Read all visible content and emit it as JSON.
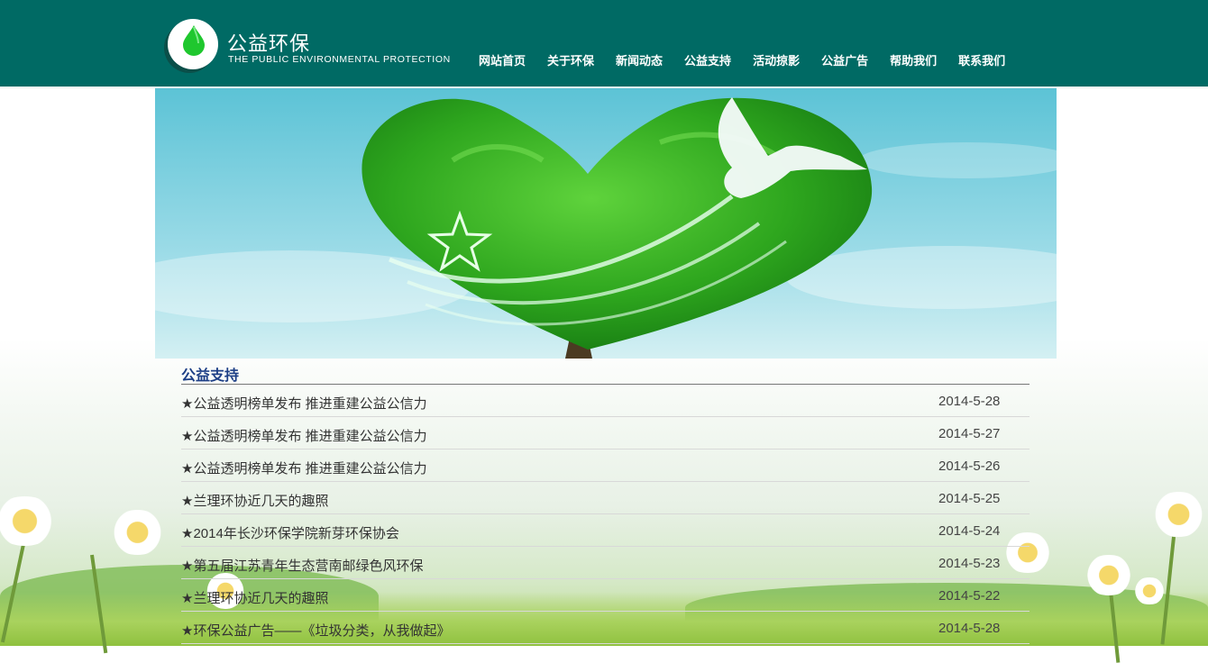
{
  "header": {
    "logo_cn": "公益环保",
    "logo_en": "THE PUBLIC ENVIRONMENTAL PROTECTION",
    "nav": [
      "网站首页",
      "关于环保",
      "新闻动态",
      "公益支持",
      "活动掠影",
      "公益广告",
      "帮助我们",
      "联系我们"
    ]
  },
  "colors": {
    "header_bg": "#006a64",
    "section_title": "#1d3f86",
    "logo_drop": "#1fc72e"
  },
  "section": {
    "title": "公益支持"
  },
  "news": [
    {
      "title": "★公益透明榜单发布 推进重建公益公信力",
      "date": "2014-5-28"
    },
    {
      "title": "★公益透明榜单发布 推进重建公益公信力",
      "date": "2014-5-27"
    },
    {
      "title": "★公益透明榜单发布 推进重建公益公信力",
      "date": "2014-5-26"
    },
    {
      "title": "★兰理环协近几天的趣照",
      "date": "2014-5-25"
    },
    {
      "title": "★2014年长沙环保学院新芽环保协会",
      "date": "2014-5-24"
    },
    {
      "title": "★第五届江苏青年生态营南邮绿色风环保",
      "date": "2014-5-23"
    },
    {
      "title": "★兰理环协近几天的趣照",
      "date": "2014-5-22"
    },
    {
      "title": "★环保公益广告——《垃圾分类，从我做起》",
      "date": "2014-5-28"
    }
  ]
}
